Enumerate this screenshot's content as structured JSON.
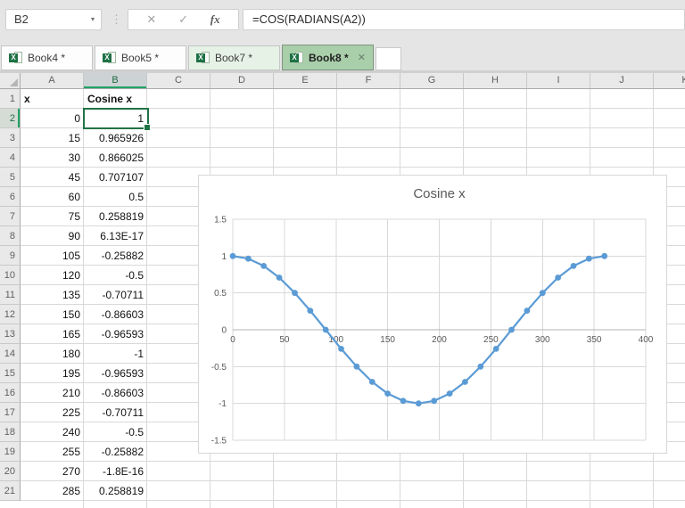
{
  "formula_bar": {
    "name_box": "B2",
    "dropdown_icon": "▾",
    "cancel_icon": "✕",
    "enter_icon": "✓",
    "fx_label": "fx",
    "formula": "=COS(RADIANS(A2))"
  },
  "workbook_tabs": [
    {
      "label": "Book4 *",
      "tint": "none",
      "active": false
    },
    {
      "label": "Book5 *",
      "tint": "none",
      "active": false
    },
    {
      "label": "Book7 *",
      "tint": "light-green",
      "active": false
    },
    {
      "label": "Book8 *",
      "tint": "green",
      "active": true,
      "close_icon": "✕"
    }
  ],
  "sheet": {
    "column_headers": [
      "A",
      "B",
      "C",
      "D",
      "E",
      "F",
      "G",
      "H",
      "I",
      "J",
      "K"
    ],
    "selected_column": "B",
    "selected_row": 2,
    "row_count": 21,
    "selected_cell": {
      "ref": "B2",
      "value": "1"
    },
    "rows": [
      {
        "a": "x",
        "b": "Cosine x",
        "bold": true
      },
      {
        "a": "0",
        "b": "1"
      },
      {
        "a": "15",
        "b": "0.965926"
      },
      {
        "a": "30",
        "b": "0.866025"
      },
      {
        "a": "45",
        "b": "0.707107"
      },
      {
        "a": "60",
        "b": "0.5"
      },
      {
        "a": "75",
        "b": "0.258819"
      },
      {
        "a": "90",
        "b": "6.13E-17"
      },
      {
        "a": "105",
        "b": "-0.25882"
      },
      {
        "a": "120",
        "b": "-0.5"
      },
      {
        "a": "135",
        "b": "-0.70711"
      },
      {
        "a": "150",
        "b": "-0.86603"
      },
      {
        "a": "165",
        "b": "-0.96593"
      },
      {
        "a": "180",
        "b": "-1"
      },
      {
        "a": "195",
        "b": "-0.96593"
      },
      {
        "a": "210",
        "b": "-0.86603"
      },
      {
        "a": "225",
        "b": "-0.70711"
      },
      {
        "a": "240",
        "b": "-0.5"
      },
      {
        "a": "255",
        "b": "-0.25882"
      },
      {
        "a": "270",
        "b": "-1.8E-16"
      },
      {
        "a": "285",
        "b": "0.258819"
      }
    ]
  },
  "chart_data": {
    "type": "line",
    "title": "Cosine x",
    "x": [
      0,
      15,
      30,
      45,
      60,
      75,
      90,
      105,
      120,
      135,
      150,
      165,
      180,
      195,
      210,
      225,
      240,
      255,
      270,
      285,
      300,
      315,
      330,
      345,
      360
    ],
    "y": [
      1,
      0.965926,
      0.866025,
      0.707107,
      0.5,
      0.258819,
      0,
      -0.258819,
      -0.5,
      -0.707107,
      -0.866025,
      -0.965926,
      -1,
      -0.965926,
      -0.866025,
      -0.707107,
      -0.5,
      -0.258819,
      0,
      0.258819,
      0.5,
      0.707107,
      0.866025,
      0.965926,
      1
    ],
    "xlabel": "",
    "ylabel": "",
    "xlim": [
      0,
      400
    ],
    "ylim": [
      -1.5,
      1.5
    ],
    "xticks": [
      0,
      50,
      100,
      150,
      200,
      250,
      300,
      350,
      400
    ],
    "yticks": [
      -1.5,
      -1,
      -0.5,
      0,
      0.5,
      1,
      1.5
    ],
    "grid": true,
    "legend_position": "none",
    "series_color": "#5B9BD5",
    "marker": "circle"
  },
  "colors": {
    "accent_green": "#217346",
    "selection_green": "#21a366",
    "active_tab_green": "#a9cfaa",
    "series_blue": "#5B9BD5",
    "chart_text": "#595959"
  }
}
